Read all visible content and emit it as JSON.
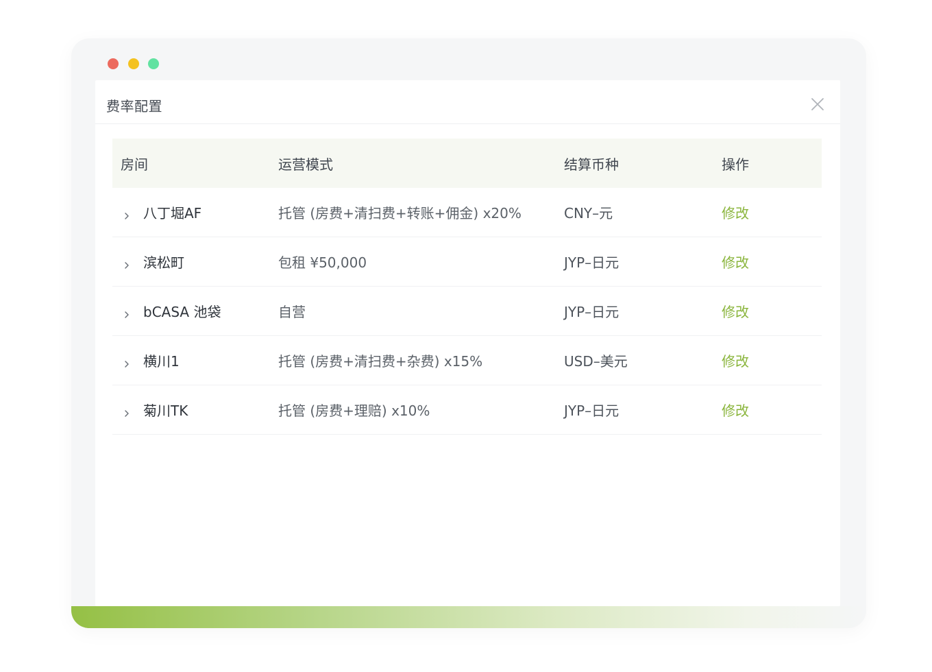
{
  "window": {
    "dots": [
      "close",
      "minimize",
      "maximize"
    ]
  },
  "dialog": {
    "title": "费率配置",
    "close_icon": "close-icon"
  },
  "table": {
    "headers": [
      "房间",
      "运营模式",
      "结算币种",
      "操作"
    ],
    "rows": [
      {
        "room": "八丁堀AF",
        "mode": "托管 (房费+清扫费+转账+佣金) x20%",
        "currency": "CNY–元",
        "action": "修改"
      },
      {
        "room": "滨松町",
        "mode": "包租 ¥50,000",
        "currency": "JYP–日元",
        "action": "修改"
      },
      {
        "room": "bCASA 池袋",
        "mode": "自营",
        "currency": "JYP–日元",
        "action": "修改"
      },
      {
        "room": "横川1",
        "mode": "托管 (房费+清扫费+杂费) x15%",
        "currency": "USD–美元",
        "action": "修改"
      },
      {
        "room": "菊川TK",
        "mode": "托管 (房费+理赔) x10%",
        "currency": "JYP–日元",
        "action": "修改"
      }
    ]
  },
  "colors": {
    "accent": "#8ab53c",
    "header_bg": "#f6f8f2",
    "dot_red": "#ec6a5e",
    "dot_yellow": "#f4c220",
    "dot_green": "#62e2a1"
  }
}
